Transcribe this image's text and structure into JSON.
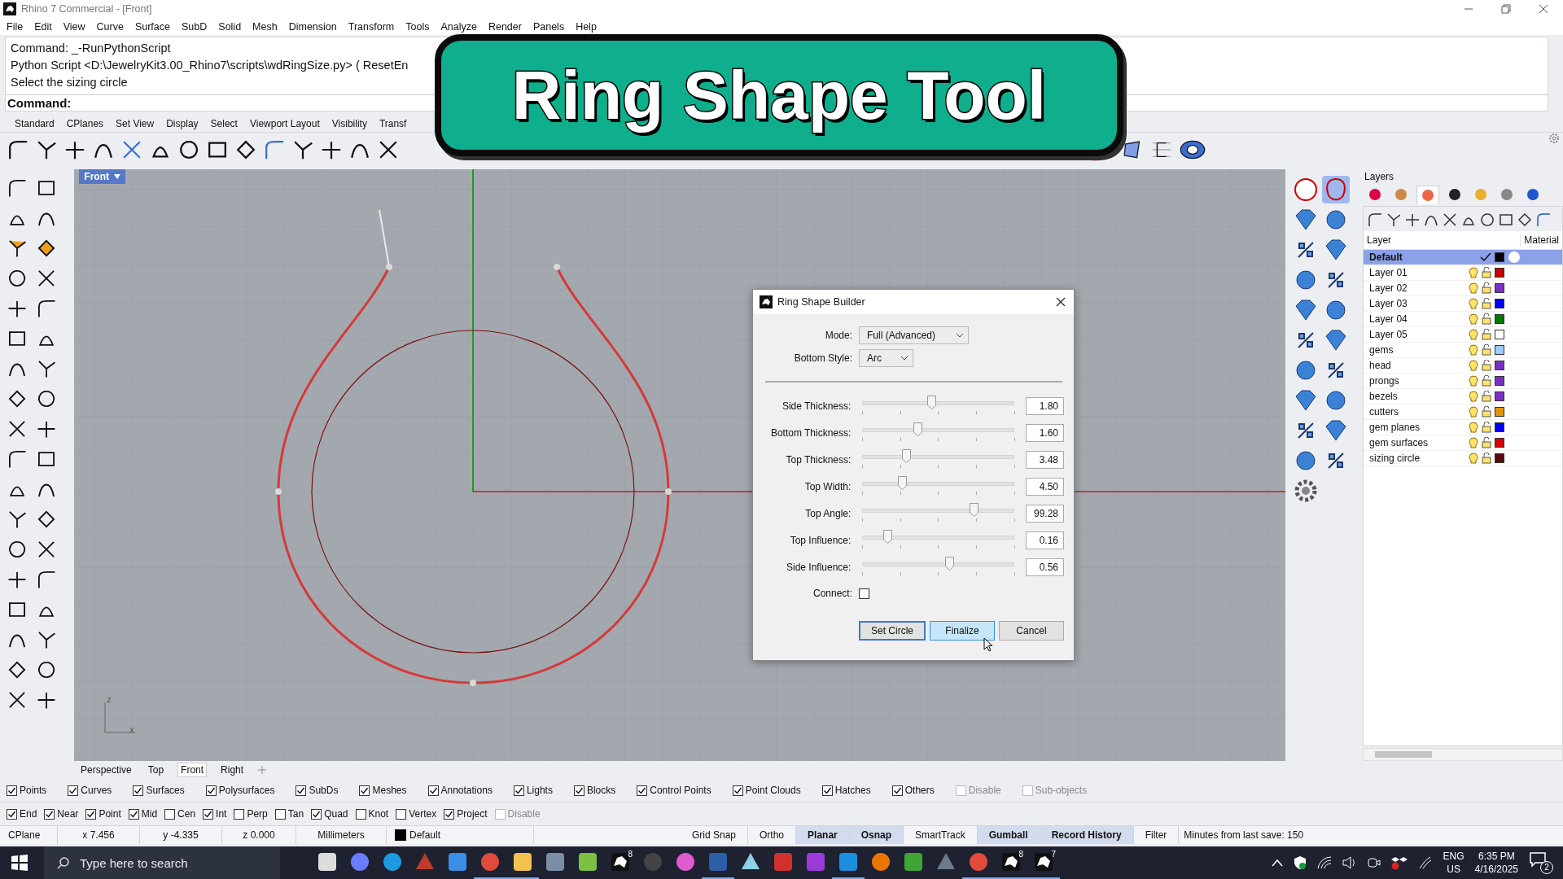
{
  "window": {
    "title": "Rhino 7 Commercial - [Front]"
  },
  "menu": [
    "File",
    "Edit",
    "View",
    "Curve",
    "Surface",
    "SubD",
    "Solid",
    "Mesh",
    "Dimension",
    "Transform",
    "Tools",
    "Analyze",
    "Render",
    "Panels",
    "Help"
  ],
  "command_history": [
    "Command: _-RunPythonScript",
    "Python Script <D:\\JewelryKit3.00_Rhino7\\scripts\\wdRingSize.py> ( ResetEn",
    "Select the sizing circle"
  ],
  "command_prompt": "Command:",
  "toolbar_tabs": [
    "Standard",
    "CPlanes",
    "Set View",
    "Display",
    "Select",
    "Viewport Layout",
    "Visibility",
    "Transf"
  ],
  "banner": {
    "text": "Ring Shape Tool"
  },
  "viewport": {
    "label": "Front",
    "axis_labels": [
      "z",
      "x"
    ]
  },
  "viewport_tabs": [
    {
      "label": "Perspective",
      "selected": false
    },
    {
      "label": "Top",
      "selected": false
    },
    {
      "label": "Front",
      "selected": true
    },
    {
      "label": "Right",
      "selected": false
    }
  ],
  "layers_panel": {
    "title": "Layers",
    "columns": [
      "Layer",
      "Material"
    ],
    "layers": [
      {
        "name": "Default",
        "current": true,
        "selected": true,
        "color": "#000000"
      },
      {
        "name": "Layer 01",
        "current": false,
        "selected": false,
        "color": "#cc0000"
      },
      {
        "name": "Layer 02",
        "current": false,
        "selected": false,
        "color": "#7b2fc9"
      },
      {
        "name": "Layer 03",
        "current": false,
        "selected": false,
        "color": "#0000ff"
      },
      {
        "name": "Layer 04",
        "current": false,
        "selected": false,
        "color": "#007a00"
      },
      {
        "name": "Layer 05",
        "current": false,
        "selected": false,
        "color": "#ffffff"
      },
      {
        "name": "gems",
        "current": false,
        "selected": false,
        "color": "#99ccff"
      },
      {
        "name": "head",
        "current": false,
        "selected": false,
        "color": "#7b2fc9"
      },
      {
        "name": "prongs",
        "current": false,
        "selected": false,
        "color": "#7b2fc9"
      },
      {
        "name": "bezels",
        "current": false,
        "selected": false,
        "color": "#7b2fc9"
      },
      {
        "name": "cutters",
        "current": false,
        "selected": false,
        "color": "#e69500"
      },
      {
        "name": "gem planes",
        "current": false,
        "selected": false,
        "color": "#0000ff"
      },
      {
        "name": "gem surfaces",
        "current": false,
        "selected": false,
        "color": "#dd0000"
      },
      {
        "name": "sizing circle",
        "current": false,
        "selected": false,
        "color": "#5a0a0a"
      }
    ]
  },
  "dialog": {
    "title": "Ring Shape Builder",
    "mode_label": "Mode:",
    "mode": "Full (Advanced)",
    "bottom_style_label": "Bottom Style:",
    "bottom_style": "Arc",
    "sliders": [
      {
        "label": "Side Thickness:",
        "level": 0.453,
        "value": "1.80"
      },
      {
        "label": "Bottom Thickness:",
        "level": 0.362,
        "value": "1.60"
      },
      {
        "label": "Top Thickness:",
        "level": 0.287,
        "value": "3.48"
      },
      {
        "label": "Top Width:",
        "level": 0.261,
        "value": "4.50"
      },
      {
        "label": "Top Angle:",
        "level": 0.732,
        "value": "99.28"
      },
      {
        "label": "Top Influence:",
        "level": 0.162,
        "value": "0.16"
      },
      {
        "label": "Side Influence:",
        "level": 0.57,
        "value": "0.56"
      }
    ],
    "connect_label": "Connect:",
    "connect": false,
    "buttons": [
      {
        "label": "Set Circle",
        "hovered": false
      },
      {
        "label": "Finalize",
        "hovered": true
      },
      {
        "label": "Cancel",
        "hovered": false
      }
    ]
  },
  "filter_bar": [
    {
      "label": "Points",
      "checked": true,
      "disabled": false
    },
    {
      "label": "Curves",
      "checked": true,
      "disabled": false
    },
    {
      "label": "Surfaces",
      "checked": true,
      "disabled": false
    },
    {
      "label": "Polysurfaces",
      "checked": true,
      "disabled": false
    },
    {
      "label": "SubDs",
      "checked": true,
      "disabled": false
    },
    {
      "label": "Meshes",
      "checked": true,
      "disabled": false
    },
    {
      "label": "Annotations",
      "checked": true,
      "disabled": false
    },
    {
      "label": "Lights",
      "checked": true,
      "disabled": false
    },
    {
      "label": "Blocks",
      "checked": true,
      "disabled": false
    },
    {
      "label": "Control Points",
      "checked": true,
      "disabled": false
    },
    {
      "label": "Point Clouds",
      "checked": true,
      "disabled": false
    },
    {
      "label": "Hatches",
      "checked": true,
      "disabled": false
    },
    {
      "label": "Others",
      "checked": true,
      "disabled": false
    },
    {
      "label": "Disable",
      "checked": false,
      "disabled": true
    },
    {
      "label": "Sub-objects",
      "checked": false,
      "disabled": true
    }
  ],
  "osnap_bar": [
    {
      "label": "End",
      "checked": true,
      "disabled": false
    },
    {
      "label": "Near",
      "checked": true,
      "disabled": false
    },
    {
      "label": "Point",
      "checked": true,
      "disabled": false
    },
    {
      "label": "Mid",
      "checked": true,
      "disabled": false
    },
    {
      "label": "Cen",
      "checked": false,
      "disabled": false
    },
    {
      "label": "Int",
      "checked": true,
      "disabled": false
    },
    {
      "label": "Perp",
      "checked": false,
      "disabled": false
    },
    {
      "label": "Tan",
      "checked": false,
      "disabled": false
    },
    {
      "label": "Quad",
      "checked": true,
      "disabled": false
    },
    {
      "label": "Knot",
      "checked": false,
      "disabled": false
    },
    {
      "label": "Vertex",
      "checked": false,
      "disabled": false
    },
    {
      "label": "Project",
      "checked": true,
      "disabled": false
    },
    {
      "label": "Disable",
      "checked": false,
      "disabled": true
    }
  ],
  "status_bar": {
    "cplane": "CPlane",
    "x": "x 7.456",
    "y": "y -4.335",
    "z": "z 0.000",
    "units": "Millimeters",
    "layer": "Default",
    "toggles": [
      {
        "label": "Grid Snap",
        "on": false
      },
      {
        "label": "Ortho",
        "on": false
      },
      {
        "label": "Planar",
        "on": true
      },
      {
        "label": "Osnap",
        "on": true
      },
      {
        "label": "SmartTrack",
        "on": false
      },
      {
        "label": "Gumball",
        "on": true
      },
      {
        "label": "Record History",
        "on": true
      },
      {
        "label": "Filter",
        "on": false
      }
    ],
    "save_info": "Minutes from last save: 150"
  },
  "taskbar": {
    "search_placeholder": "Type here to search",
    "apps": [
      {
        "kind": "taskview",
        "running": false
      },
      {
        "kind": "copilot",
        "running": false
      },
      {
        "kind": "edge",
        "running": false
      },
      {
        "kind": "pencil",
        "running": false
      },
      {
        "kind": "store",
        "running": false
      },
      {
        "kind": "chrome",
        "running": true
      },
      {
        "kind": "folder",
        "running": true
      },
      {
        "kind": "calculator",
        "running": false
      },
      {
        "kind": "notepad",
        "running": false
      },
      {
        "kind": "rhino",
        "running": false,
        "badge": "8"
      },
      {
        "kind": "obs",
        "running": false
      },
      {
        "kind": "palette",
        "running": false
      },
      {
        "kind": "word",
        "running": true
      },
      {
        "kind": "glass",
        "running": false
      },
      {
        "kind": "publisher",
        "running": false
      },
      {
        "kind": "photo",
        "running": false
      },
      {
        "kind": "designer",
        "running": true
      },
      {
        "kind": "blender",
        "running": false
      },
      {
        "kind": "camtasia",
        "running": false
      },
      {
        "kind": "diamond",
        "running": false
      },
      {
        "kind": "chrome",
        "running": true
      },
      {
        "kind": "rhino",
        "running": true,
        "badge": "8"
      },
      {
        "kind": "rhino",
        "running": true,
        "badge": "7"
      }
    ],
    "tray": {
      "language": "ENG",
      "region": "US",
      "time": "6:35 PM",
      "date": "4/16/2025",
      "notifications": "2"
    }
  }
}
